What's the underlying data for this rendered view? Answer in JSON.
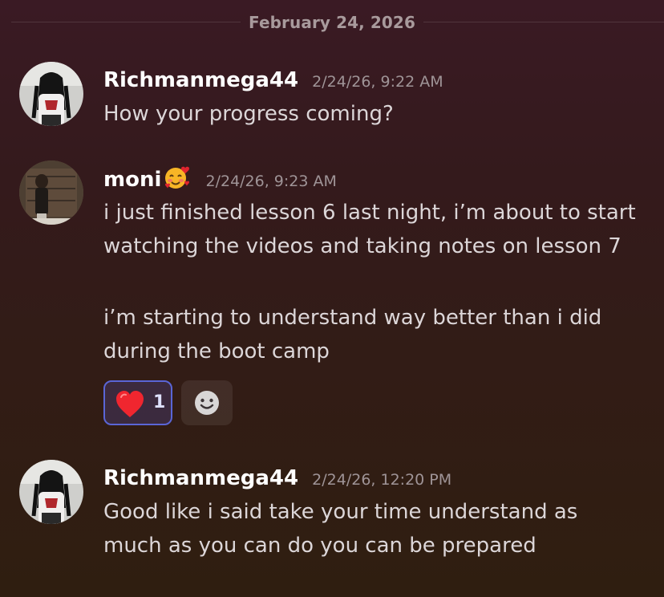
{
  "date_divider": "February 24, 2026",
  "messages": [
    {
      "author": "Richmanmega44",
      "timestamp": "2/24/26, 9:22 AM",
      "lines": [
        "How your progress coming?"
      ]
    },
    {
      "author": "moni",
      "author_emoji": "smiling-face-with-hearts",
      "timestamp": "2/24/26, 9:23 AM",
      "lines": [
        "i just finished lesson 6 last night, i’m about to start watching the videos and taking notes on lesson 7",
        "i’m starting to understand way better than i did during the boot camp"
      ],
      "reactions": [
        {
          "icon": "red-heart-icon",
          "count": "1",
          "reacted": true
        }
      ],
      "add_reaction_icon": "smiley-icon"
    },
    {
      "author": "Richmanmega44",
      "timestamp": "2/24/26, 12:20 PM",
      "lines": [
        "Good like i said take your time understand as much as you can do you can be prepared"
      ]
    }
  ],
  "colors": {
    "reaction_border": "#5a65d6",
    "timestamp": "#9f9497",
    "message_text": "#dcd6d8"
  }
}
